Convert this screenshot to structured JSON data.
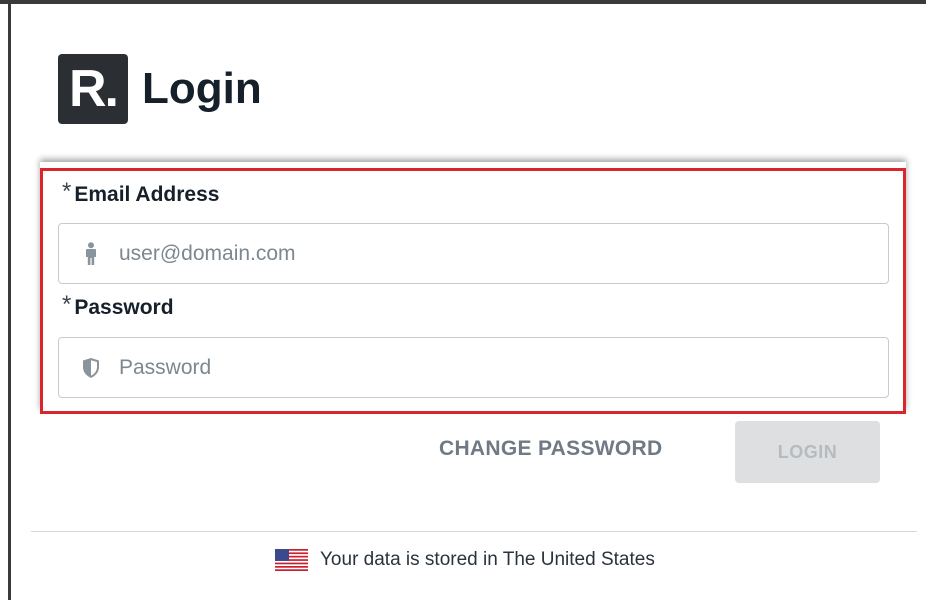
{
  "header": {
    "logo_text": "R.",
    "title": "Login"
  },
  "form": {
    "email": {
      "required_mark": "*",
      "label": "Email Address",
      "placeholder": "user@domain.com",
      "value": "",
      "icon": "person-icon"
    },
    "password": {
      "required_mark": "*",
      "label": "Password",
      "placeholder": "Password",
      "value": "",
      "icon": "shield-icon"
    },
    "highlight_color": "#d8262c"
  },
  "actions": {
    "change_password_label": "CHANGE PASSWORD",
    "login_label": "LOGIN",
    "login_enabled": false
  },
  "footer": {
    "flag_icon": "us-flag-icon",
    "text": "Your data is stored in The United States"
  }
}
